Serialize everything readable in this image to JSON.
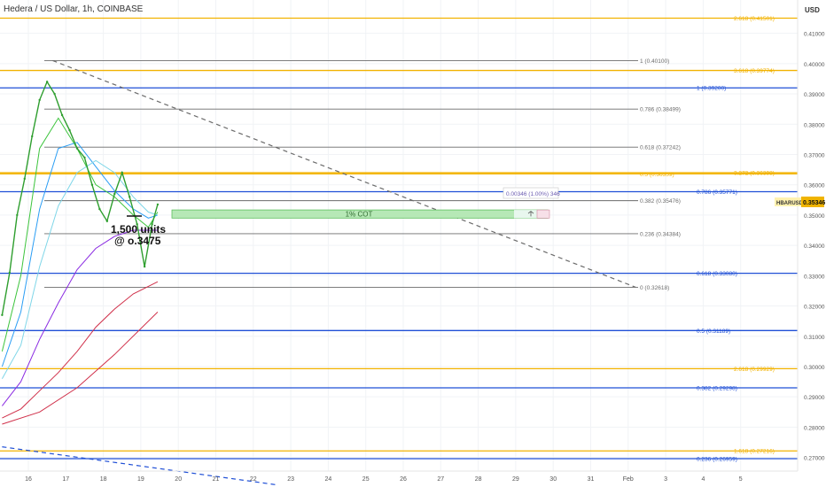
{
  "header": {
    "title": "Hedera / US Dollar, 1h, COINBASE",
    "currency": "USD"
  },
  "price_tag": {
    "symbol": "HBARUSD",
    "value": "0.35346"
  },
  "annotations": {
    "position_line1": "1,500 units",
    "position_line2": "@ o.3475",
    "cot_label": "1% COT",
    "measure_label": "0.00346 (1.00%) 346"
  },
  "colors": {
    "gold": "#f2b200",
    "blue": "#1f4fd6",
    "gray": "#6b6b6b",
    "green_zone": "#b6e8b6",
    "candle": "#2e9e2e",
    "ma_blue": "#2a9df4",
    "ma_light": "#7fd6e8",
    "ma_purple": "#8a2be2",
    "ma_red": "#d0304a",
    "ma_green": "#3cc43c"
  },
  "chart_data": {
    "type": "line",
    "title": "Hedera / US Dollar, 1h, COINBASE",
    "xlabel": "",
    "ylabel": "",
    "ylim": [
      0.2655,
      0.421
    ],
    "y_ticks": [
      "0.41000",
      "0.40000",
      "0.39000",
      "0.38000",
      "0.37000",
      "0.36000",
      "0.35000",
      "0.34000",
      "0.33000",
      "0.32000",
      "0.31000",
      "0.30000",
      "0.29000",
      "0.28000",
      "0.27000"
    ],
    "x_ticks": [
      "16",
      "17",
      "18",
      "19",
      "20",
      "21",
      "22",
      "23",
      "24",
      "25",
      "26",
      "27",
      "28",
      "29",
      "30",
      "31",
      "Feb",
      "3",
      "4",
      "5"
    ],
    "levels": [
      {
        "label": "2.618 (0.41501)",
        "value": 0.41501,
        "color": "gold"
      },
      {
        "label": "1 (0.40100)",
        "value": 0.401,
        "color": "gray"
      },
      {
        "label": "3.618 (0.39774)",
        "value": 0.39774,
        "color": "gold"
      },
      {
        "label": "1 (0.39200)",
        "value": 0.392,
        "color": "blue"
      },
      {
        "label": "0.786 (0.38499)",
        "value": 0.38499,
        "color": "gray"
      },
      {
        "label": "0.618 (0.37242)",
        "value": 0.37242,
        "color": "gray"
      },
      {
        "label": "0.5 (0.36359)",
        "value": 0.36359,
        "color": "gold"
      },
      {
        "label": "3.272 (0.36398)",
        "value": 0.36398,
        "color": "gold"
      },
      {
        "label": "0.786 (0.35771)",
        "value": 0.35771,
        "color": "blue"
      },
      {
        "label": "0.382 (0.35476)",
        "value": 0.35476,
        "color": "gray"
      },
      {
        "label": "0.236 (0.34384)",
        "value": 0.34384,
        "color": "gray"
      },
      {
        "label": "0.618 (0.33080)",
        "value": 0.3308,
        "color": "blue"
      },
      {
        "label": "0 (0.32618)",
        "value": 0.32618,
        "color": "gray"
      },
      {
        "label": "0.5 (0.31189)",
        "value": 0.31189,
        "color": "blue"
      },
      {
        "label": "2.618 (0.29929)",
        "value": 0.29929,
        "color": "gold"
      },
      {
        "label": "0.382 (0.29298)",
        "value": 0.29298,
        "color": "blue"
      },
      {
        "label": "1.618 (0.27216)",
        "value": 0.27216,
        "color": "gold"
      },
      {
        "label": "0.236 (0.26959)",
        "value": 0.26959,
        "color": "blue"
      }
    ],
    "cot_zone": {
      "y_low": 0.349,
      "y_high": 0.3517
    },
    "price_series": [
      {
        "x": 15.3,
        "y": 0.317
      },
      {
        "x": 15.5,
        "y": 0.331
      },
      {
        "x": 15.7,
        "y": 0.35
      },
      {
        "x": 15.9,
        "y": 0.362
      },
      {
        "x": 16.1,
        "y": 0.376
      },
      {
        "x": 16.3,
        "y": 0.388
      },
      {
        "x": 16.5,
        "y": 0.394
      },
      {
        "x": 16.7,
        "y": 0.39
      },
      {
        "x": 16.9,
        "y": 0.383
      },
      {
        "x": 17.1,
        "y": 0.378
      },
      {
        "x": 17.3,
        "y": 0.372
      },
      {
        "x": 17.5,
        "y": 0.369
      },
      {
        "x": 17.7,
        "y": 0.36
      },
      {
        "x": 17.9,
        "y": 0.352
      },
      {
        "x": 18.1,
        "y": 0.348
      },
      {
        "x": 18.3,
        "y": 0.357
      },
      {
        "x": 18.5,
        "y": 0.364
      },
      {
        "x": 18.7,
        "y": 0.356
      },
      {
        "x": 18.9,
        "y": 0.347
      },
      {
        "x": 19.1,
        "y": 0.333
      },
      {
        "x": 19.3,
        "y": 0.347
      },
      {
        "x": 19.45,
        "y": 0.3535
      }
    ],
    "series": [
      {
        "color": "ma_green",
        "values": [
          {
            "x": 15.3,
            "y": 0.305
          },
          {
            "x": 15.8,
            "y": 0.33
          },
          {
            "x": 16.3,
            "y": 0.372
          },
          {
            "x": 16.8,
            "y": 0.382
          },
          {
            "x": 17.3,
            "y": 0.372
          },
          {
            "x": 17.8,
            "y": 0.36
          },
          {
            "x": 18.3,
            "y": 0.356
          },
          {
            "x": 18.8,
            "y": 0.35
          },
          {
            "x": 19.2,
            "y": 0.346
          },
          {
            "x": 19.45,
            "y": 0.351
          }
        ]
      },
      {
        "color": "ma_blue",
        "values": [
          {
            "x": 15.3,
            "y": 0.3
          },
          {
            "x": 15.8,
            "y": 0.318
          },
          {
            "x": 16.3,
            "y": 0.352
          },
          {
            "x": 16.8,
            "y": 0.372
          },
          {
            "x": 17.3,
            "y": 0.374
          },
          {
            "x": 17.8,
            "y": 0.366
          },
          {
            "x": 18.3,
            "y": 0.358
          },
          {
            "x": 18.8,
            "y": 0.352
          },
          {
            "x": 19.2,
            "y": 0.349
          },
          {
            "x": 19.45,
            "y": 0.35
          }
        ]
      },
      {
        "color": "ma_light",
        "values": [
          {
            "x": 15.3,
            "y": 0.296
          },
          {
            "x": 15.8,
            "y": 0.307
          },
          {
            "x": 16.3,
            "y": 0.333
          },
          {
            "x": 16.8,
            "y": 0.353
          },
          {
            "x": 17.3,
            "y": 0.364
          },
          {
            "x": 17.8,
            "y": 0.368
          },
          {
            "x": 18.3,
            "y": 0.364
          },
          {
            "x": 18.8,
            "y": 0.356
          },
          {
            "x": 19.2,
            "y": 0.351
          },
          {
            "x": 19.45,
            "y": 0.35
          }
        ]
      },
      {
        "color": "ma_purple",
        "values": [
          {
            "x": 15.3,
            "y": 0.287
          },
          {
            "x": 15.8,
            "y": 0.295
          },
          {
            "x": 16.3,
            "y": 0.309
          },
          {
            "x": 16.8,
            "y": 0.321
          },
          {
            "x": 17.3,
            "y": 0.332
          },
          {
            "x": 17.8,
            "y": 0.339
          },
          {
            "x": 18.3,
            "y": 0.343
          },
          {
            "x": 18.8,
            "y": 0.345
          },
          {
            "x": 19.45,
            "y": 0.345
          }
        ]
      },
      {
        "color": "ma_red",
        "values": [
          {
            "x": 15.3,
            "y": 0.283
          },
          {
            "x": 15.8,
            "y": 0.286
          },
          {
            "x": 16.3,
            "y": 0.292
          },
          {
            "x": 16.8,
            "y": 0.298
          },
          {
            "x": 17.3,
            "y": 0.305
          },
          {
            "x": 17.8,
            "y": 0.313
          },
          {
            "x": 18.3,
            "y": 0.319
          },
          {
            "x": 18.8,
            "y": 0.324
          },
          {
            "x": 19.45,
            "y": 0.328
          }
        ]
      },
      {
        "color": "ma_red",
        "values": [
          {
            "x": 15.3,
            "y": 0.281
          },
          {
            "x": 16.3,
            "y": 0.285
          },
          {
            "x": 17.3,
            "y": 0.293
          },
          {
            "x": 18.3,
            "y": 0.304
          },
          {
            "x": 19.45,
            "y": 0.318
          }
        ]
      }
    ],
    "trendlines": [
      {
        "from": {
          "x": 16.65,
          "y": 0.401
        },
        "to": {
          "x": 32.2,
          "y": 0.32618
        },
        "color": "gray"
      },
      {
        "from": {
          "x": 15.3,
          "y": 0.2735
        },
        "to": {
          "x": 22.6,
          "y": 0.261
        },
        "color": "blue"
      }
    ]
  }
}
